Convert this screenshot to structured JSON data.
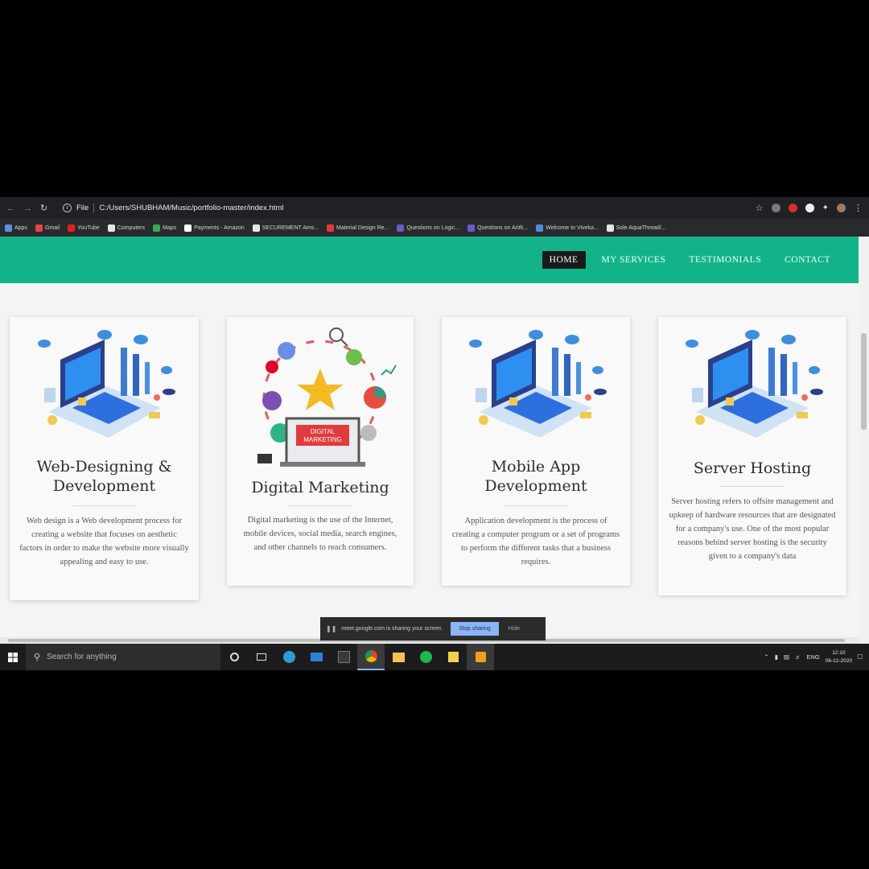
{
  "browser": {
    "url_prefix": "File",
    "url": "C:/Users/SHUBHAM/Music/portfolio-master/index.html",
    "bookmarks": [
      {
        "label": "Apps",
        "color": "#5f8de8"
      },
      {
        "label": "Gmail",
        "color": "#e8453c"
      },
      {
        "label": "YouTube",
        "color": "#e62117"
      },
      {
        "label": "Computers",
        "color": "#e6e6e6"
      },
      {
        "label": "Maps",
        "color": "#34a853"
      },
      {
        "label": "Payments - Amazon",
        "color": "#ffffff"
      },
      {
        "label": "SECUREMENT Ams...",
        "color": "#e6e6e6"
      },
      {
        "label": "Material Design Re...",
        "color": "#e53935"
      },
      {
        "label": "Questions on Logic...",
        "color": "#6a5acd"
      },
      {
        "label": "Questions on Arith...",
        "color": "#6a5acd"
      },
      {
        "label": "Welcome to Viveka...",
        "color": "#4a90d9"
      },
      {
        "label": "Sole AquaThread/...",
        "color": "#e6e6e6"
      }
    ]
  },
  "nav": {
    "links": [
      "HOME",
      "MY SERVICES",
      "TESTIMONIALS",
      "CONTACT"
    ],
    "active": "HOME",
    "color": "#13b38a"
  },
  "services": [
    {
      "title_line1": "Web-Designing &",
      "title_line2": "Development",
      "description": "Web design is a Web development process for creating a website that focuses on aesthetic factors in order to make the website more visually appealing and easy to use.",
      "illustration": "isometric-computer-illustration"
    },
    {
      "title_line1": "Digital Marketing",
      "title_line2": "",
      "description": "Digital marketing is the use of the Internet, mobile devices, social media, search engines, and other channels to reach consumers.",
      "illustration": "digital-marketing-illustration",
      "screen_text_1": "DIGITAL",
      "screen_text_2": "MARKETING"
    },
    {
      "title_line1": "Mobile App",
      "title_line2": "Development",
      "description": "Application development is the process of creating a computer program or a set of programs to perform the different tasks that a business requires.",
      "illustration": "isometric-computer-illustration"
    },
    {
      "title_line1": "Server Hosting",
      "title_line2": "",
      "description": "Server hosting refers to offsite management and upkeep of hardware resources that are designated for a company's use. One of the most popular reasons behind server hosting is the security given to a company's data",
      "illustration": "isometric-computer-illustration"
    }
  ],
  "sharing_bar": {
    "message": "meet.google.com is sharing your screen.",
    "stop_label": "Stop sharing",
    "hide_label": "Hide"
  },
  "taskbar": {
    "search_placeholder": "Search for anything",
    "language": "ENG",
    "time": "12:10",
    "date": "06-12-2020"
  }
}
